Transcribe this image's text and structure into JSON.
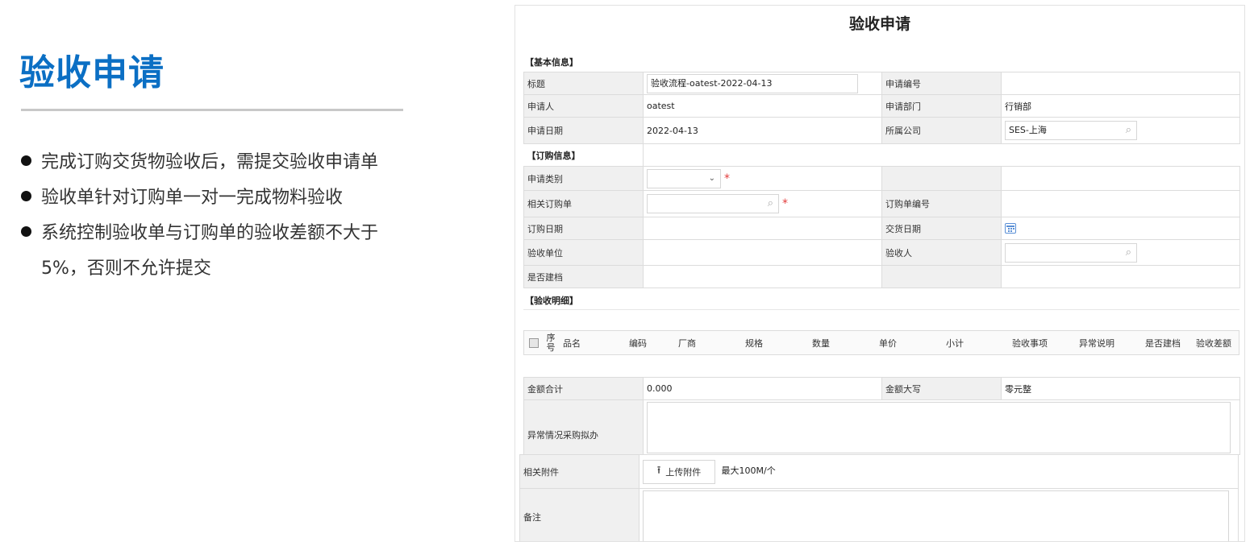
{
  "slide": {
    "title": "验收申请",
    "bullets": [
      "完成订购交货物验收后，需提交验收申请单",
      "验收单针对订购单一对一完成物料验收",
      "系统控制验收单与订购单的验收差额不大于5%，否则不允许提交"
    ]
  },
  "form": {
    "title": "验收申请",
    "sections": {
      "basic": "【基本信息】",
      "order": "【订购信息】",
      "detail": "【验收明细】"
    },
    "basic": {
      "title_label": "标题",
      "title_value": "验收流程-oatest-2022-04-13",
      "apply_no_label": "申请编号",
      "apply_no_value": "",
      "applicant_label": "申请人",
      "applicant_value": "oatest",
      "dept_label": "申请部门",
      "dept_value": "行销部",
      "date_label": "申请日期",
      "date_value": "2022-04-13",
      "company_label": "所属公司",
      "company_value": "SES-上海"
    },
    "order": {
      "category_label": "申请类别",
      "category_value": "",
      "related_order_label": "相关订购单",
      "order_no_label": "订购单编号",
      "order_date_label": "订购日期",
      "delivery_date_label": "交货日期",
      "accept_unit_label": "验收单位",
      "acceptor_label": "验收人",
      "archived_label": "是否建档"
    },
    "detail_columns": [
      "序号",
      "品名",
      "编码",
      "厂商",
      "规格",
      "数量",
      "单价",
      "小计",
      "验收事项",
      "异常说明",
      "是否建档",
      "验收差额"
    ],
    "totals": {
      "sum_label": "金额合计",
      "sum_value": "0.000",
      "upper_label": "金额大写",
      "upper_value": "零元整",
      "exception_label": "异常情况采购拟办",
      "attachment_label": "相关附件",
      "upload_label": "上传附件",
      "upload_hint": "最大100M/个",
      "remark_label": "备注"
    },
    "required_mark": "*",
    "icons": {
      "search": "search-icon",
      "dropdown": "chevron-down-icon",
      "calendar": "calendar-icon",
      "upload": "upload-icon"
    },
    "colors": {
      "title_blue": "#0b6fc4",
      "link_blue": "#1f4f8f",
      "required_red": "#e23b3b",
      "label_bg": "#f0f0f0"
    }
  }
}
